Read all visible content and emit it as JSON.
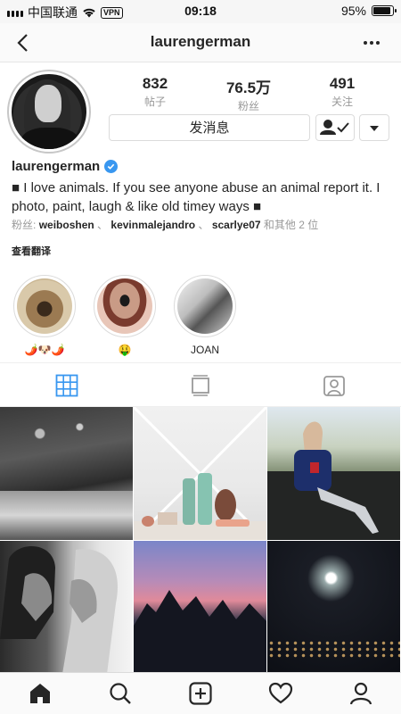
{
  "status_bar": {
    "carrier": "中国联通",
    "vpn": "VPN",
    "time": "09:18",
    "battery_text": "95%",
    "battery_level": 0.95
  },
  "nav": {
    "title": "laurengerman",
    "back_icon": "chevron-left-icon",
    "more_icon": "more-horizontal-icon"
  },
  "profile": {
    "stats": [
      {
        "value": "832",
        "label": "帖子"
      },
      {
        "value": "76.5万",
        "label": "粉丝"
      },
      {
        "value": "491",
        "label": "关注"
      }
    ],
    "message_button": "发消息",
    "username": "laurengerman",
    "bio": "■ I love animals. If you see anyone abuse an animal report it. I photo, paint, laugh & like old timey ways ■",
    "followers_prefix": "粉丝:",
    "followers": [
      "weiboshen",
      "kevinmalejandro",
      "scarlye07"
    ],
    "followers_sep": "、",
    "followers_suffix": "和其他 2 位",
    "translate": "查看翻译"
  },
  "highlights": [
    {
      "caption": "🌶️🐶🌶️"
    },
    {
      "caption": "🤑"
    },
    {
      "caption": "JOAN"
    }
  ],
  "tabs": [
    "grid-icon",
    "feed-icon",
    "tagged-icon"
  ],
  "bottom_nav": [
    "home-icon",
    "search-icon",
    "add-icon",
    "heart-icon",
    "profile-icon"
  ],
  "colors": {
    "verified": "#3897f0",
    "active_tab": "#3897f0",
    "text": "#262626",
    "muted": "#999999"
  }
}
